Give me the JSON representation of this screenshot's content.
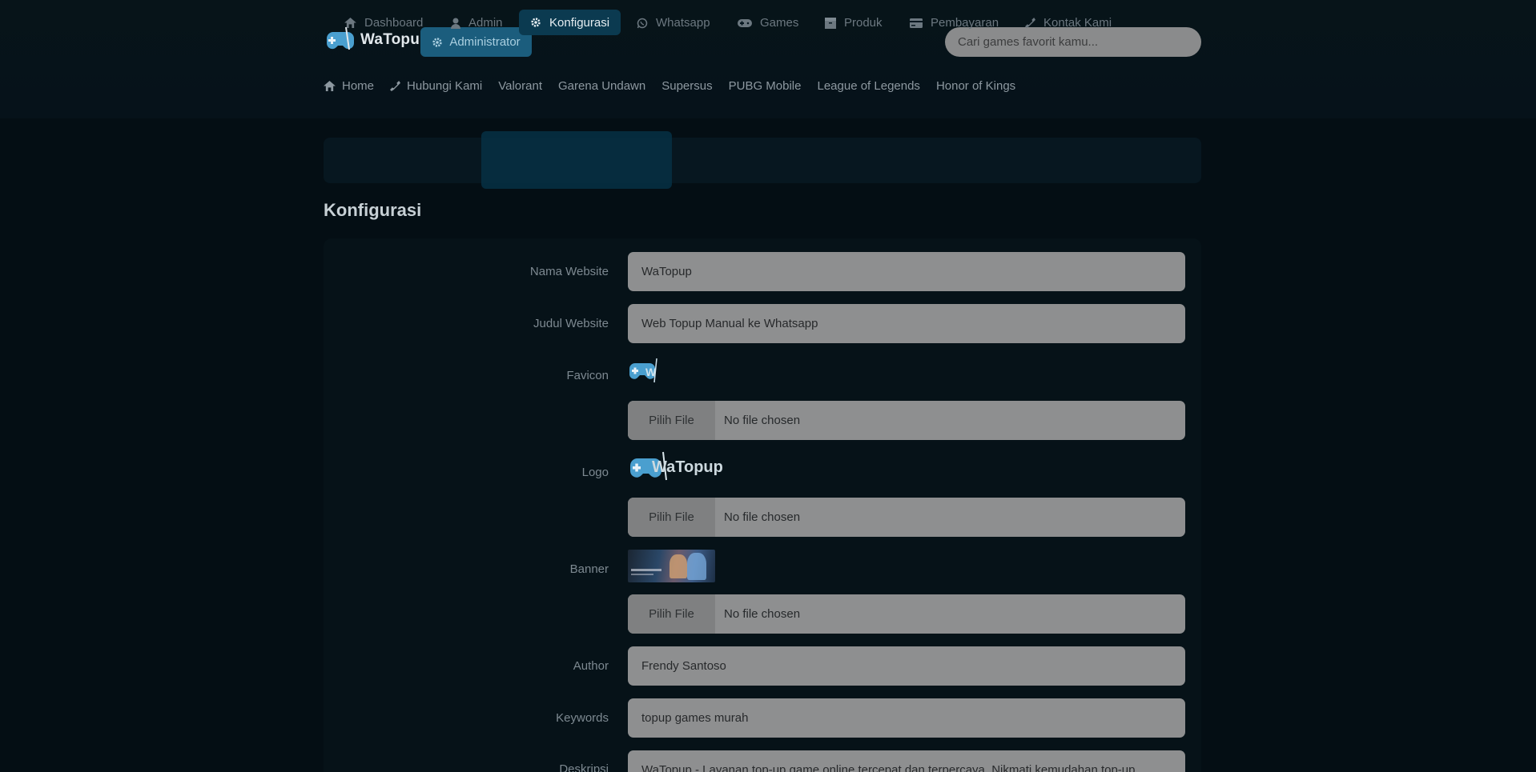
{
  "brand": {
    "logo_text": "WaTopup",
    "accent": "#4fa3d1"
  },
  "header": {
    "admin_label": "Administrator",
    "search_placeholder": "Cari games favorit kamu..."
  },
  "topnav": [
    {
      "label": "Home",
      "icon": "home-icon"
    },
    {
      "label": "Hubungi Kami",
      "icon": "phone-icon"
    },
    {
      "label": "Valorant"
    },
    {
      "label": "Garena Undawn"
    },
    {
      "label": "Supersus"
    },
    {
      "label": "PUBG Mobile"
    },
    {
      "label": "League of Legends"
    },
    {
      "label": "Honor of Kings"
    }
  ],
  "adminnav": [
    {
      "label": "Dashboard",
      "icon": "home-icon"
    },
    {
      "label": "Admin",
      "icon": "user-icon"
    },
    {
      "label": "Konfigurasi",
      "icon": "gear-icon",
      "active": true
    },
    {
      "label": "Whatsapp",
      "icon": "whatsapp-icon"
    },
    {
      "label": "Games",
      "icon": "gamepad-icon"
    },
    {
      "label": "Produk",
      "icon": "box-icon"
    },
    {
      "label": "Pembayaran",
      "icon": "credit-card-icon"
    },
    {
      "label": "Kontak Kami",
      "icon": "phone-icon"
    }
  ],
  "page": {
    "title": "Konfigurasi"
  },
  "form": {
    "nama_website": {
      "label": "Nama Website",
      "value": "WaTopup"
    },
    "judul_website": {
      "label": "Judul Website",
      "value": "Web Topup Manual ke Whatsapp"
    },
    "favicon": {
      "label": "Favicon",
      "button": "Pilih File",
      "status": "No file chosen",
      "preview_text": "W"
    },
    "logo": {
      "label": "Logo",
      "button": "Pilih File",
      "status": "No file chosen",
      "preview_text": "WaTopup"
    },
    "banner": {
      "label": "Banner",
      "button": "Pilih File",
      "status": "No file chosen"
    },
    "author": {
      "label": "Author",
      "value": "Frendy Santoso"
    },
    "keywords": {
      "label": "Keywords",
      "value": "topup games murah"
    },
    "deskripsi": {
      "label": "Deskripsi",
      "value": "WaTopup - Layanan top-up game online tercepat dan terpercaya. Nikmati kemudahan top-up"
    }
  }
}
